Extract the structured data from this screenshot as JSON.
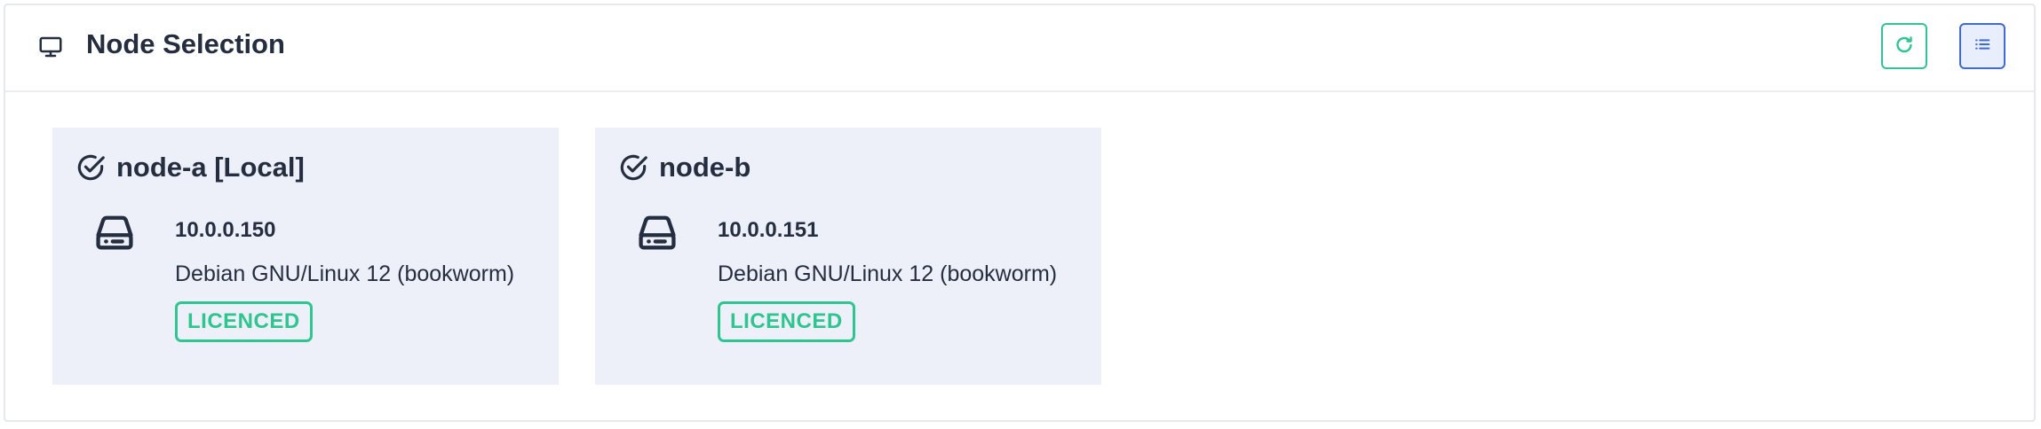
{
  "panel": {
    "title": "Node Selection",
    "title_icon": "monitor-icon",
    "actions": [
      {
        "name": "refresh",
        "icon": "refresh-icon",
        "color": "#2ec58f"
      },
      {
        "name": "list-view",
        "icon": "list-icon",
        "color": "#3d6ad6"
      }
    ]
  },
  "nodes": [
    {
      "title": "node-a [Local]",
      "ip": "10.0.0.150",
      "os": "Debian GNU/Linux 12 (bookworm)",
      "license": "LICENCED",
      "selected_icon": "check-circle-icon",
      "drive_icon": "hard-drive-icon"
    },
    {
      "title": "node-b",
      "ip": "10.0.0.151",
      "os": "Debian GNU/Linux 12 (bookworm)",
      "license": "LICENCED",
      "selected_icon": "check-circle-icon",
      "drive_icon": "hard-drive-icon"
    }
  ],
  "colors": {
    "accent_green": "#2ec58f",
    "accent_blue": "#3d6ad6",
    "card_bg": "#edf0f8",
    "text": "#252e41"
  }
}
